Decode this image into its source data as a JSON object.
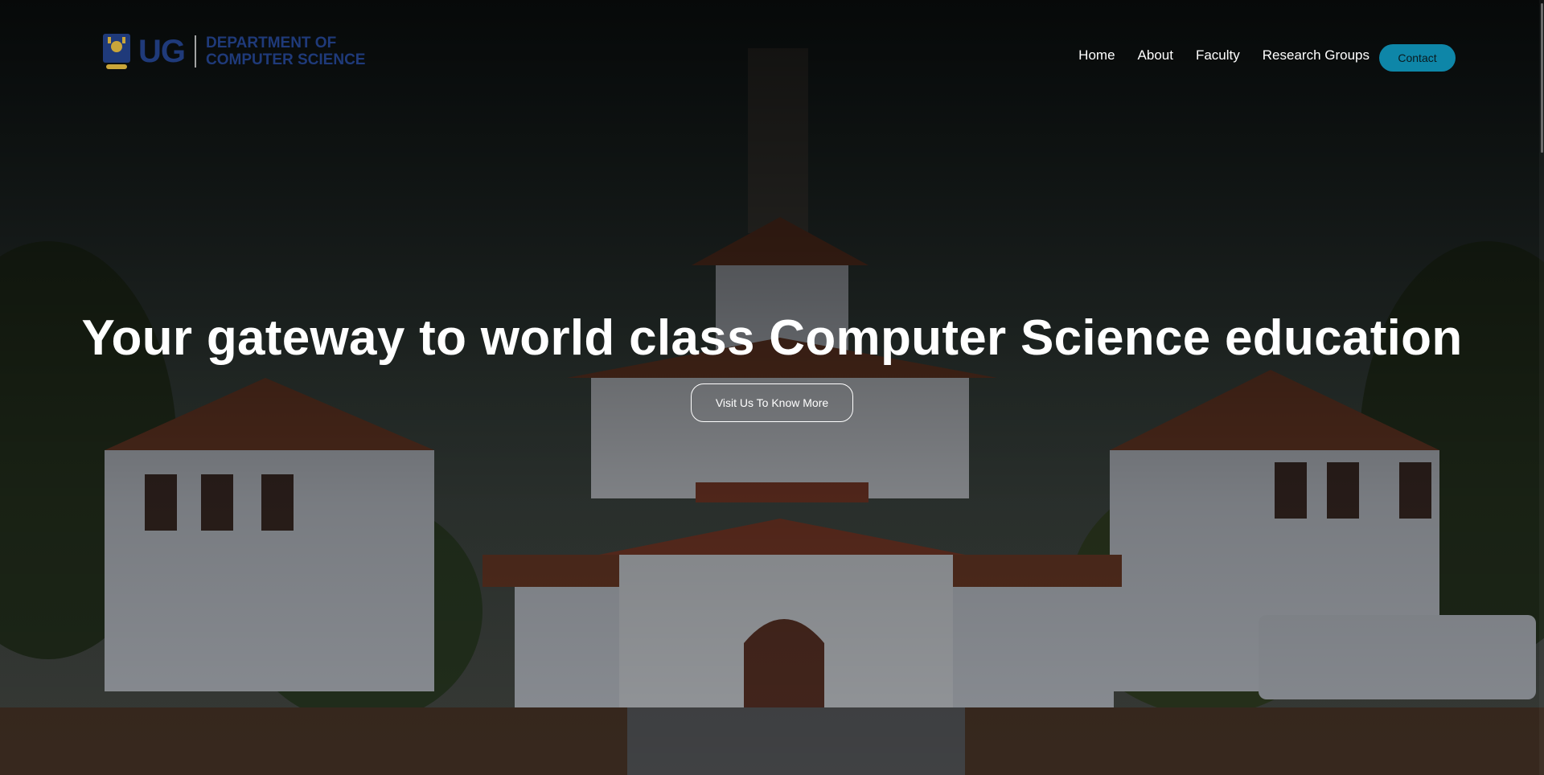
{
  "brand": {
    "logo_mark": "UG",
    "dept_line1": "DEPARTMENT OF",
    "dept_line2": "COMPUTER SCIENCE"
  },
  "nav": {
    "items": [
      {
        "label": "Home"
      },
      {
        "label": "About"
      },
      {
        "label": "Faculty"
      },
      {
        "label": "Research Groups"
      }
    ],
    "contact_label": "Contact"
  },
  "hero": {
    "headline": "Your gateway to world class Computer Science education",
    "cta_label": "Visit Us To Know More"
  },
  "colors": {
    "brand_blue": "#1f3a7a",
    "accent_teal": "#0e86a8",
    "text": "#ffffff"
  }
}
